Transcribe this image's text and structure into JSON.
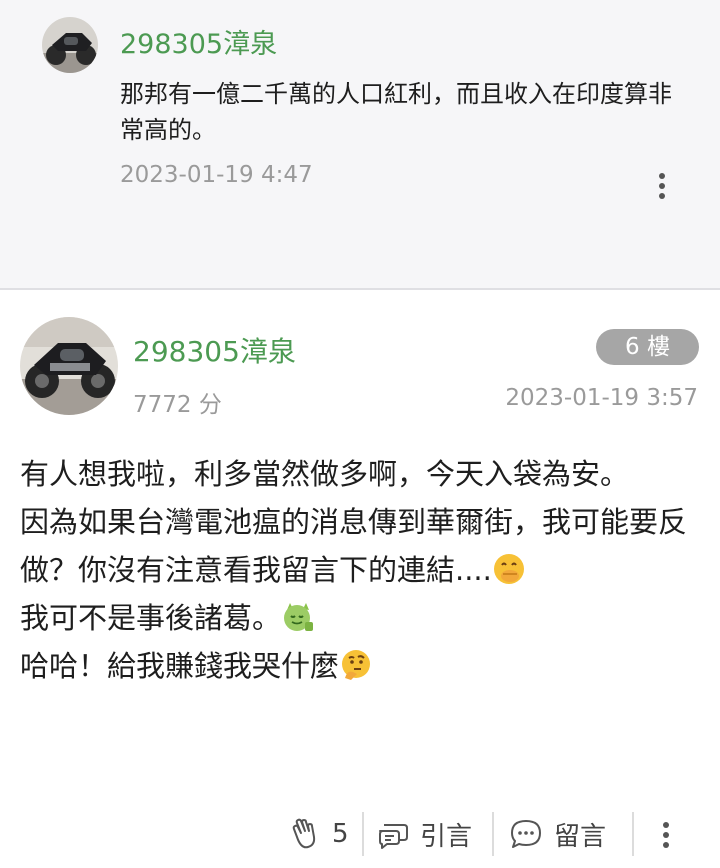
{
  "reply": {
    "author": "298305漳泉",
    "text": "那邦有一億二千萬的人口紅利，而且收入在印度算非常高的。",
    "time": "2023-01-19 4:47",
    "menu_icon": "more-vertical-icon"
  },
  "post": {
    "author": "298305漳泉",
    "floor_badge": "6 樓",
    "score": "7772 分",
    "time": "2023-01-19 3:57",
    "lines": {
      "l1": "有人想我啦，利多當然做多啊，今天入袋為安。",
      "l2": "因為如果台灣電池瘟的消息傳到華爾街，我可能要反做？你沒有注意看我留言下的連結....",
      "l3": "我可不是事後諸葛。",
      "l4": "哈哈！給我賺錢我哭什麼"
    },
    "emojis": [
      "face-with-hand-over-mouth",
      "green-devil-thumbs-up",
      "thinking-face"
    ]
  },
  "actions": {
    "clap_icon": "clap-hands-icon",
    "clap_count": "5",
    "quote_label": "引言",
    "comment_label": "留言",
    "accent": "#4c9a52"
  }
}
